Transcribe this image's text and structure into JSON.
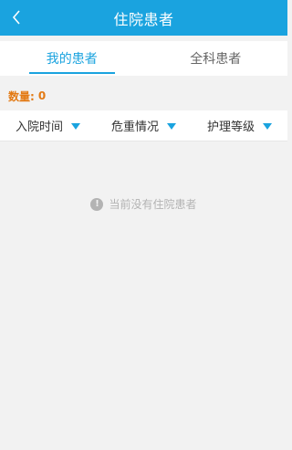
{
  "header": {
    "title": "住院患者",
    "back_icon": "chevron-left-icon"
  },
  "tabs": [
    {
      "label": "我的患者",
      "active": true
    },
    {
      "label": "全科患者",
      "active": false
    }
  ],
  "count": {
    "label": "数量:",
    "value": "0"
  },
  "filters": [
    {
      "label": "入院时间",
      "icon": "triangle-down-icon"
    },
    {
      "label": "危重情况",
      "icon": "triangle-down-icon"
    },
    {
      "label": "护理等级",
      "icon": "triangle-down-icon"
    }
  ],
  "empty_state": {
    "icon": "exclamation-circle-icon",
    "text": "当前没有住院患者"
  },
  "colors": {
    "primary": "#1aa3df",
    "count_text": "#e37a14",
    "background": "#f2f2f2"
  }
}
